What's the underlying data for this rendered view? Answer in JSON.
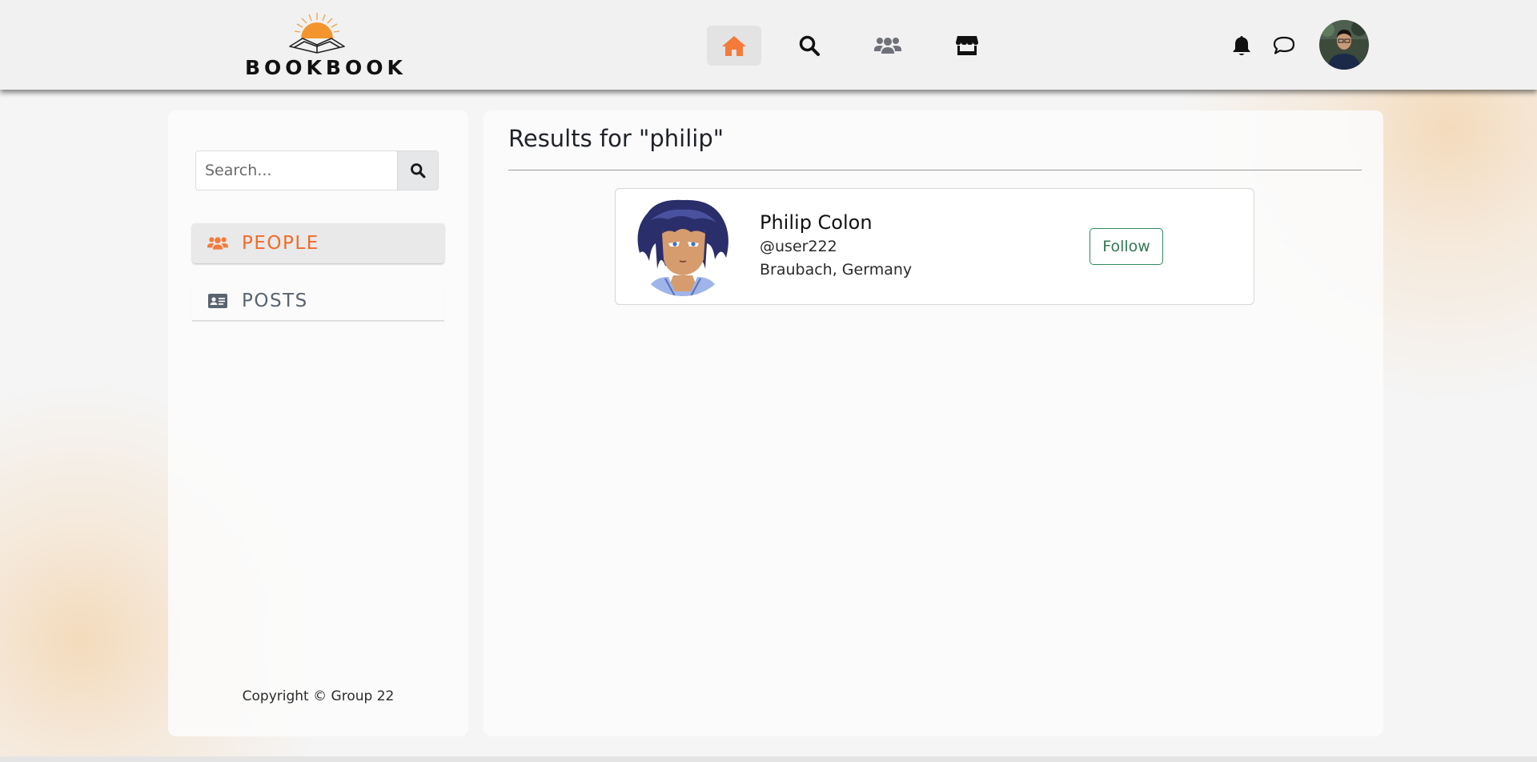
{
  "header": {
    "logo_text": "BOOKBOOK",
    "nav": [
      {
        "name": "home",
        "icon": "home-icon",
        "active": true
      },
      {
        "name": "search",
        "icon": "search-icon",
        "active": false
      },
      {
        "name": "groups",
        "icon": "users-icon",
        "active": false
      },
      {
        "name": "marketplace",
        "icon": "store-icon",
        "active": false
      }
    ],
    "right_icons": [
      "bell-icon",
      "chat-bubble-icon"
    ],
    "accent_color": "#f47a3a"
  },
  "sidebar": {
    "search": {
      "placeholder": "Search...",
      "value": ""
    },
    "filters": [
      {
        "label": "PEOPLE",
        "icon": "people-icon",
        "active": true
      },
      {
        "label": "POSTS",
        "icon": "id-card-icon",
        "active": false
      }
    ],
    "copyright": "Copyright © Group 22"
  },
  "main": {
    "title": "Results for \"philip\"",
    "results": [
      {
        "name": "Philip Colon",
        "handle": "@user222",
        "location": "Braubach, Germany",
        "follow_label": "Follow"
      }
    ]
  }
}
